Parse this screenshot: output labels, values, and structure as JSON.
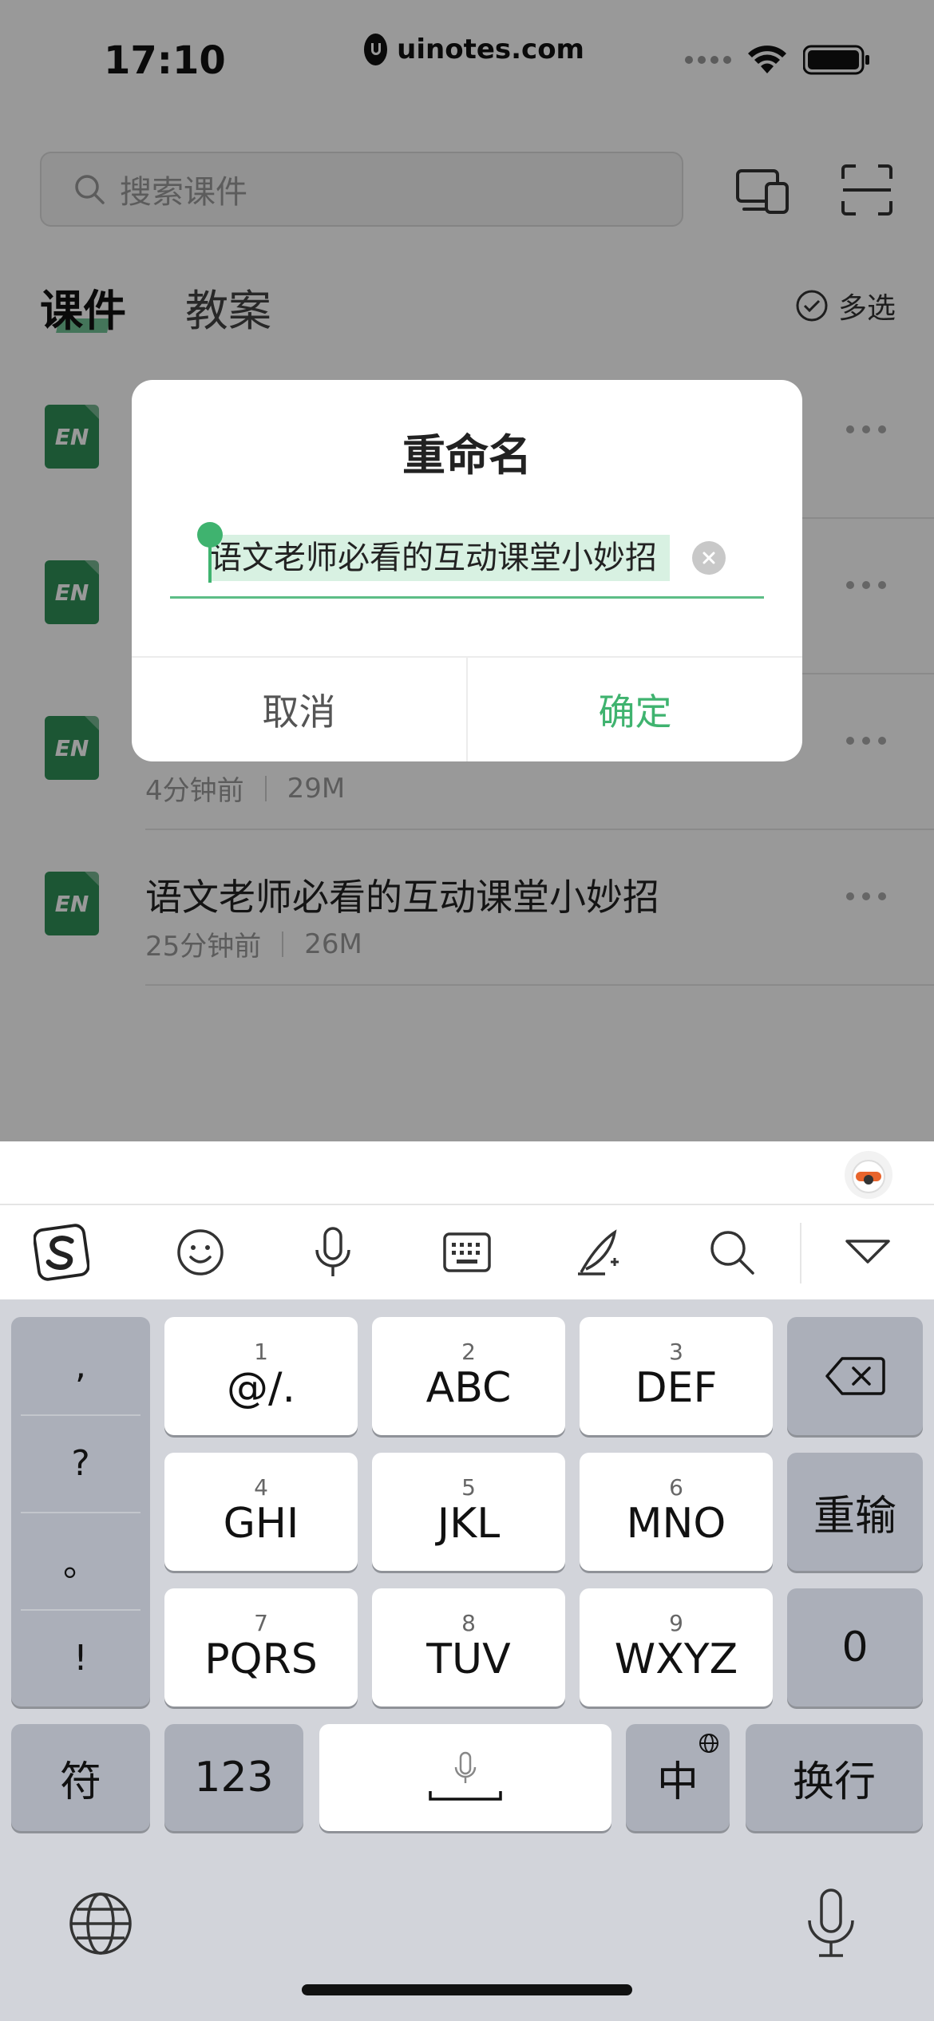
{
  "status": {
    "time": "17:10",
    "url": "uinotes.com"
  },
  "search": {
    "placeholder": "搜索课件"
  },
  "tabs": [
    {
      "label": "课件",
      "active": true
    },
    {
      "label": "教案",
      "active": false
    }
  ],
  "multi_select": "多选",
  "files": [
    {
      "icon": "EN",
      "name": "",
      "time": "",
      "size": ""
    },
    {
      "icon": "EN",
      "name": "",
      "time": "",
      "size": ""
    },
    {
      "icon": "EN",
      "name": "",
      "time": "4分钟前",
      "size": "29M"
    },
    {
      "icon": "EN",
      "name": "语文老师必看的互动课堂小妙招",
      "time": "25分钟前",
      "size": "26M"
    }
  ],
  "dialog": {
    "title": "重命名",
    "input_value": "语文老师必看的互动课堂小妙招",
    "cancel": "取消",
    "confirm": "确定"
  },
  "keyboard": {
    "punctuation": [
      ",",
      "?",
      "。",
      "!"
    ],
    "keys_row1": [
      {
        "num": "1",
        "label": "@/."
      },
      {
        "num": "2",
        "label": "ABC"
      },
      {
        "num": "3",
        "label": "DEF"
      }
    ],
    "keys_row2": [
      {
        "num": "4",
        "label": "GHI"
      },
      {
        "num": "5",
        "label": "JKL"
      },
      {
        "num": "6",
        "label": "MNO"
      }
    ],
    "keys_row3": [
      {
        "num": "7",
        "label": "PQRS"
      },
      {
        "num": "8",
        "label": "TUV"
      },
      {
        "num": "9",
        "label": "WXYZ"
      }
    ],
    "reinput": "重输",
    "zero": "0",
    "symbols": "符",
    "numbers": "123",
    "chinese": "中",
    "newline": "换行"
  },
  "colors": {
    "accent": "#3fb36f",
    "file_icon": "#2f8f58",
    "keyboard_bg": "#d2d4da"
  }
}
